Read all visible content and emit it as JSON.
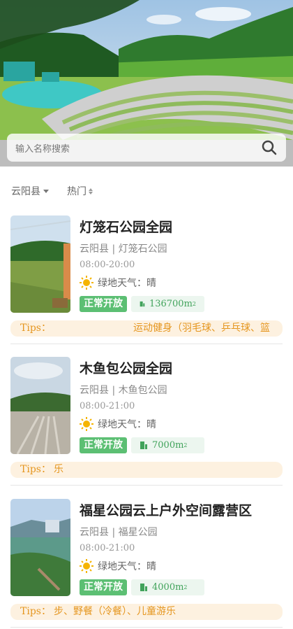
{
  "search": {
    "placeholder": "输入名称搜索",
    "icon": "search-icon"
  },
  "filters": {
    "county": "云阳县",
    "sort": "热门"
  },
  "parks": [
    {
      "name": "灯笼石公园全园",
      "location": "云阳县 | 灯笼石公园",
      "hours": "08:00-20:00",
      "weather": "绿地天气：晴",
      "status": "正常开放",
      "area": "136700m",
      "area_unit_sup": "2",
      "tips_label": "Tips：",
      "tips_text": "运动健身（羽毛球、乒乓球、篮"
    },
    {
      "name": "木鱼包公园全园",
      "location": "云阳县 | 木鱼包公园",
      "hours": "08:00-21:00",
      "weather": "绿地天气：晴",
      "status": "正常开放",
      "area": "7000m",
      "area_unit_sup": "2",
      "tips_label": "Tips：",
      "tips_text": "乐"
    },
    {
      "name": "福星公园云上户外空间露营区",
      "location": "云阳县 | 福星公园",
      "hours": "08:00-21:00",
      "weather": "绿地天气：晴",
      "status": "正常开放",
      "area": "4000m",
      "area_unit_sup": "2",
      "tips_label": "Tips：",
      "tips_text": "步、野餐（冷餐）、儿童游乐"
    }
  ],
  "colors": {
    "status_green": "#5cbf73",
    "tips_orange": "#e5961f",
    "tips_bg": "#fdf1e0"
  }
}
